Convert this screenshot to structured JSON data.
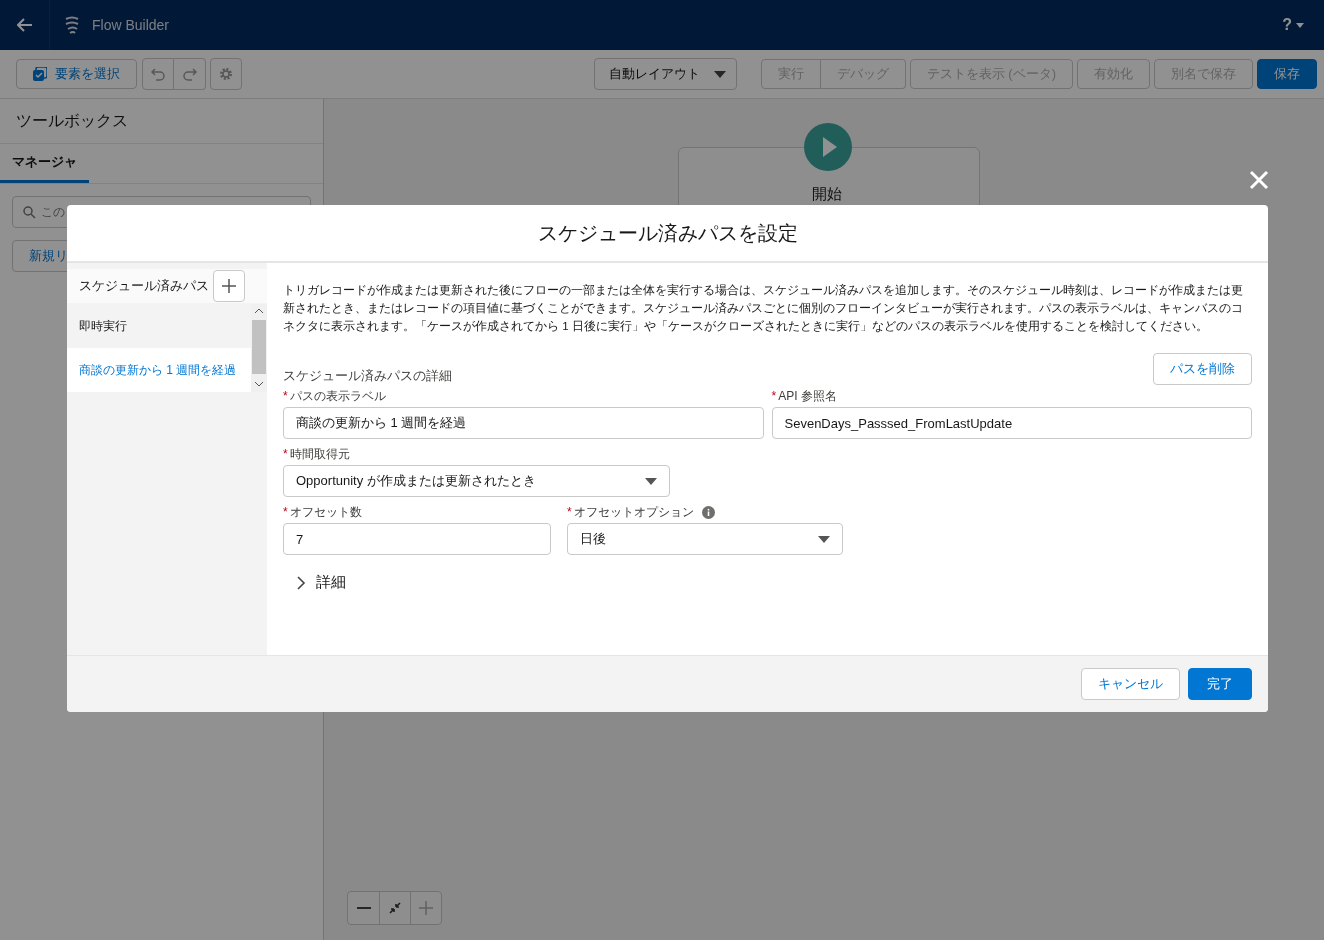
{
  "app_header": {
    "title": "Flow Builder",
    "help": "?"
  },
  "toolbar": {
    "select_button": "要素を選択",
    "layout_menu": "自動レイアウト",
    "action_groups": [
      [
        {
          "label": "実行",
          "disabled": true,
          "kind": "neutral"
        },
        {
          "label": "デバッグ",
          "disabled": true,
          "kind": "neutral"
        }
      ],
      [
        {
          "label": "テストを表示 (ベータ)",
          "disabled": true,
          "kind": "neutral"
        }
      ],
      [
        {
          "label": "有効化",
          "disabled": true,
          "kind": "neutral"
        }
      ],
      [
        {
          "label": "別名で保存",
          "disabled": true,
          "kind": "neutral"
        }
      ],
      [
        {
          "label": "保存",
          "disabled": false,
          "kind": "brand"
        }
      ]
    ]
  },
  "toolbox": {
    "title": "ツールボックス",
    "tabs": [
      {
        "label": "マネージャ",
        "selected": true
      }
    ],
    "search": {
      "placeholder": "この"
    },
    "new_button": "新規リ"
  },
  "canvas": {
    "start_node": {
      "label": "開始"
    }
  },
  "modal": {
    "title": "スケジュール済みパスを設定",
    "paths_header": "スケジュール済みパス",
    "paths": [
      {
        "label": "即時実行",
        "selected": false
      },
      {
        "label": "商談の更新から 1 週間を経過",
        "selected": true
      }
    ],
    "description": "トリガレコードが作成または更新された後にフローの一部または全体を実行する場合は、スケジュール済みパスを追加します。そのスケジュール時刻は、レコードが作成または更新されたとき、またはレコードの項目値に基づくことができます。スケジュール済みパスごとに個別のフローインタビューが実行されます。パスの表示ラベルは、キャンバスのコネクタに表示されます。「ケースが作成されてから 1 日後に実行」や「ケースがクローズされたときに実行」などのパスの表示ラベルを使用することを検討してください。",
    "details_title": "スケジュール済みパスの詳細",
    "delete_button": "パスを削除",
    "field_rows": [
      [
        {
          "label": "パスの表示ラベル",
          "required_mark": "*",
          "kind": "text",
          "value": "商談の更新から 1 週間を経過"
        },
        {
          "label": "API 参照名",
          "required_mark": "*",
          "kind": "text",
          "value": "SevenDays_Passsed_FromLastUpdate"
        }
      ],
      [
        {
          "label": "時間取得元",
          "required_mark": "*",
          "kind": "select",
          "value": "Opportunity が作成または更新されたとき"
        }
      ],
      [
        {
          "label": "オフセット数",
          "required_mark": "*",
          "kind": "text",
          "value": "7"
        },
        {
          "label": "オフセットオプション",
          "required_mark": "*",
          "kind": "select",
          "value": "日後",
          "info": true
        }
      ]
    ],
    "advanced": {
      "label": "詳細",
      "expanded": false
    },
    "buttons": [
      {
        "label": "キャンセル",
        "kind": "neutral"
      },
      {
        "label": "完了",
        "kind": "brand"
      }
    ]
  }
}
